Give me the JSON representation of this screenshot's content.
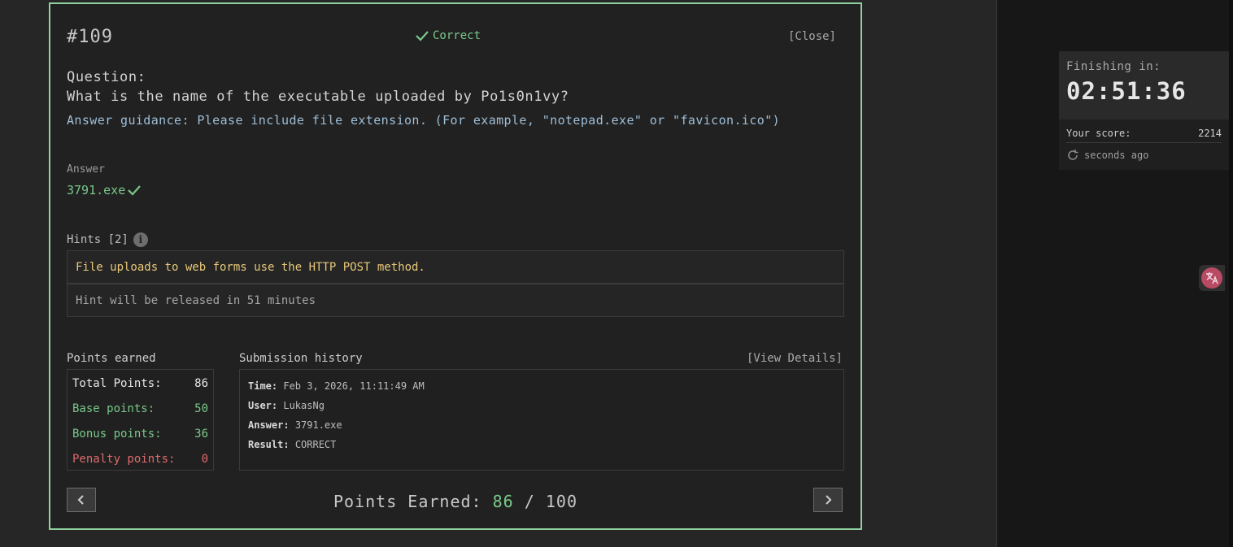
{
  "modal": {
    "question_number": "#109",
    "status": "Correct",
    "close_label": "[Close]",
    "question_label": "Question:",
    "question_text": "What is the name of the executable uploaded by Po1s0n1vy?",
    "guidance": "Answer guidance: Please include file extension. (For example, \"notepad.exe\" or \"favicon.ico\")",
    "answer_label": "Answer",
    "answer_value": "3791.exe",
    "hints_title": "Hints [2]",
    "hints": [
      "File uploads to web forms use the HTTP POST method.",
      "Hint will be released in 51 minutes"
    ],
    "points_earned_label": "Points earned",
    "points": {
      "total_label": "Total Points:",
      "total": "86",
      "base_label": "Base points:",
      "base": "50",
      "bonus_label": "Bonus points:",
      "bonus": "36",
      "penalty_label": "Penalty points:",
      "penalty": "0"
    },
    "submission_history_label": "Submission history",
    "view_details_label": "[View Details]",
    "submission": {
      "time_label": "Time:",
      "time": "Feb 3, 2026, 11:11:49 AM",
      "user_label": "User:",
      "user": "LukasNg",
      "answer_label": "Answer:",
      "answer": "3791.exe",
      "result_label": "Result:",
      "result": "CORRECT"
    },
    "footer": {
      "prefix": "Points Earned:",
      "earned": "86",
      "separator": "/",
      "max": "100"
    }
  },
  "sidebar": {
    "timer_label": "Finishing in:",
    "timer_value": "02:51:36",
    "score_label": "Your score:",
    "score_value": "2214",
    "refresh_text": "seconds ago"
  },
  "icons": {
    "status": "checkmark-icon",
    "answer": "checkmark-icon",
    "hints_info": "info-icon",
    "prev": "chevron-left-icon",
    "next": "chevron-right-icon",
    "refresh": "refresh-icon",
    "translate": "translate-icon"
  },
  "colors": {
    "accent_green": "#79c98a",
    "modal_border": "#8fd19e",
    "guidance_blue": "#9fbfd8",
    "hint_yellow": "#e8c97a",
    "penalty_red": "#e0696d",
    "translate_pink": "#b84a64"
  }
}
